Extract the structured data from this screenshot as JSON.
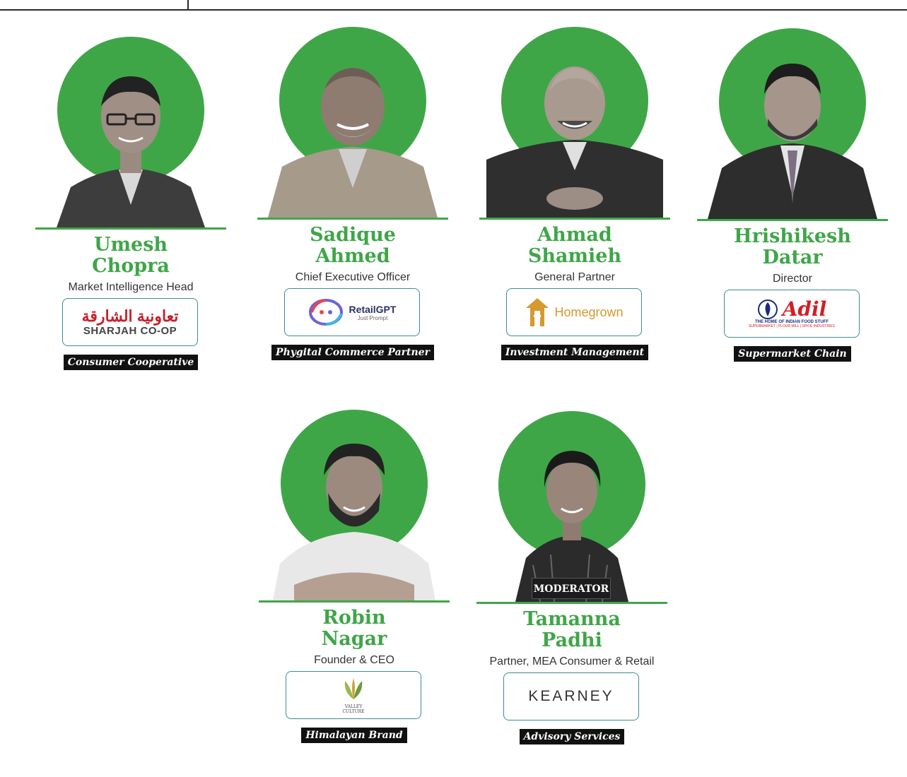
{
  "speakers": [
    {
      "first": "Umesh",
      "last": "Chopra",
      "role": "Market Intelligence Head",
      "logo_text_ar": "تعاونية الشارقة",
      "logo_text_en": "SHARJAH CO-OP",
      "tag": "Consumer Cooperative"
    },
    {
      "first": "Sadique",
      "last": "Ahmed",
      "role": "Chief Executive Officer",
      "logo_text": "RetailGPT",
      "logo_sub": "Just Prompt",
      "tag": "Phygital Commerce Partner"
    },
    {
      "first": "Ahmad",
      "last": "Shamieh",
      "role": "General Partner",
      "logo_text": "Homegrown",
      "tag": "Investment Management"
    },
    {
      "first": "Hrishikesh",
      "last": "Datar",
      "role": "Director",
      "logo_text": "Adil",
      "logo_sub": "THE HOME OF INDIAN FOOD STUFF",
      "logo_sub2": "SUPERMARKET | FLOUR MILL | SPICE INDUSTRIES",
      "tag": "Supermarket Chain"
    },
    {
      "first": "Robin",
      "last": "Nagar",
      "role": "Founder & CEO",
      "logo_text": "VALLEY",
      "logo_sub": "CULTURE",
      "tag": "Himalayan  Brand"
    },
    {
      "first": "Tamanna",
      "last": "Padhi",
      "role": "Partner, MEA Consumer & Retail",
      "logo_text": "KEARNEY",
      "badge": "MODERATOR",
      "tag": "Advisory Services"
    }
  ],
  "colors": {
    "accent": "#3fa648",
    "tag_bg": "#111111"
  }
}
